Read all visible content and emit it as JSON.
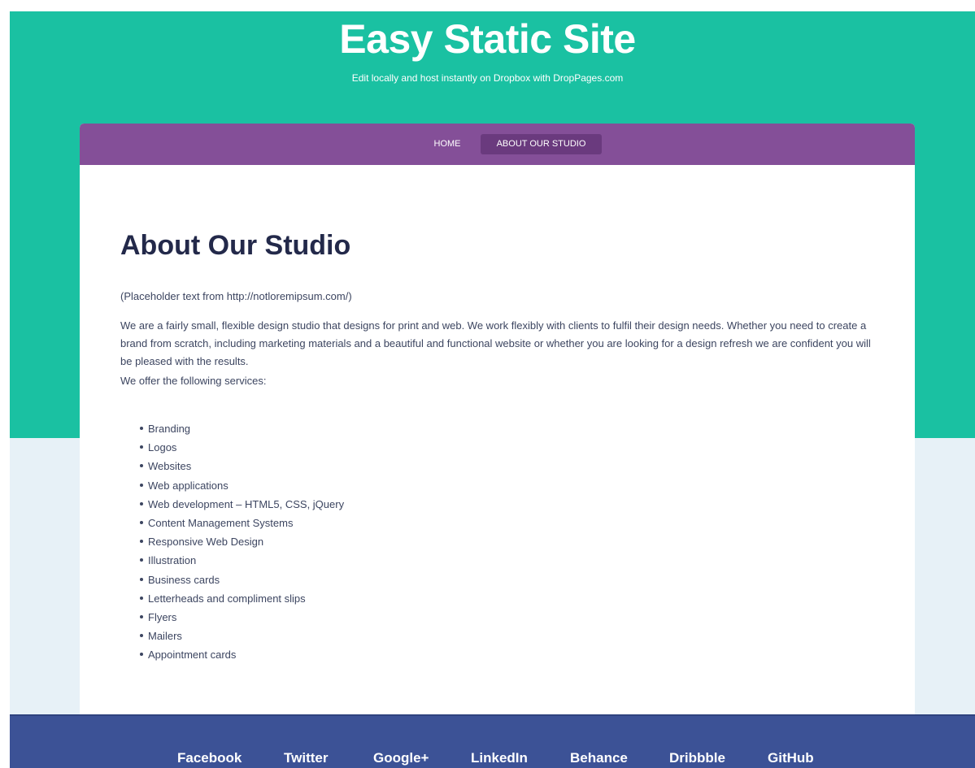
{
  "site": {
    "title": "Easy Static Site",
    "tagline": "Edit locally and host instantly on Dropbox with DropPages.com"
  },
  "nav": {
    "items": [
      {
        "label": "HOME",
        "active": false
      },
      {
        "label": "ABOUT OUR STUDIO",
        "active": true
      }
    ]
  },
  "page": {
    "heading": "About Our Studio",
    "placeholder_prefix": "(Placeholder text from ",
    "placeholder_link": "http://notloremipsum.com/",
    "placeholder_suffix": ")",
    "intro": "We are a fairly small, flexible design studio that designs for print and web. We work flexibly with clients to fulfil their design needs. Whether you need to create a brand from scratch, including marketing materials and a beautiful and functional website or whether you are looking for a design refresh we are confident you will be pleased with the results.",
    "offer": "We offer the following services:",
    "services": [
      "Branding",
      "Logos",
      "Websites",
      "Web applications",
      "Web development – HTML5, CSS, jQuery",
      "Content Management Systems",
      "Responsive Web Design",
      "Illustration",
      "Business cards",
      "Letterheads and compliment slips",
      "Flyers",
      "Mailers",
      "Appointment cards"
    ]
  },
  "footer": {
    "links": [
      "Facebook",
      "Twitter",
      "Google+",
      "LinkedIn",
      "Behance",
      "Dribbble",
      "GitHub"
    ]
  },
  "colors": {
    "hero": "#1ac1a2",
    "nav": "#844f98",
    "nav_active": "#6a3a7e",
    "footer": "#3c5296",
    "page_bg": "#e7f1f7",
    "heading": "#23294a"
  }
}
